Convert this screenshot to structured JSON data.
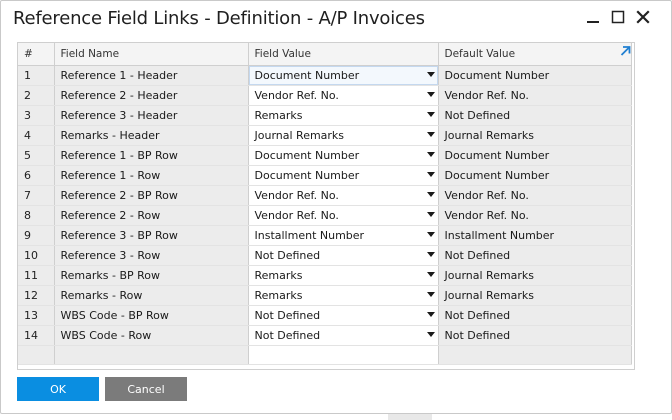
{
  "window": {
    "title": "Reference Field Links - Definition - A/P Invoices"
  },
  "grid": {
    "headers": [
      "#",
      "Field Name",
      "Field Value",
      "Default Value"
    ],
    "rows": [
      {
        "num": "1",
        "field_name": "Reference 1 - Header",
        "field_value": "Document Number",
        "default_value": "Document Number"
      },
      {
        "num": "2",
        "field_name": "Reference 2 - Header",
        "field_value": "Vendor Ref. No.",
        "default_value": "Vendor Ref. No."
      },
      {
        "num": "3",
        "field_name": "Reference 3 - Header",
        "field_value": "Remarks",
        "default_value": "Not Defined"
      },
      {
        "num": "4",
        "field_name": "Remarks - Header",
        "field_value": "Journal Remarks",
        "default_value": "Journal Remarks"
      },
      {
        "num": "5",
        "field_name": "Reference 1 - BP Row",
        "field_value": "Document Number",
        "default_value": "Document Number"
      },
      {
        "num": "6",
        "field_name": "Reference 1 - Row",
        "field_value": "Document Number",
        "default_value": "Document Number"
      },
      {
        "num": "7",
        "field_name": "Reference 2 - BP Row",
        "field_value": "Vendor Ref. No.",
        "default_value": "Vendor Ref. No."
      },
      {
        "num": "8",
        "field_name": "Reference 2 - Row",
        "field_value": "Vendor Ref. No.",
        "default_value": "Vendor Ref. No."
      },
      {
        "num": "9",
        "field_name": "Reference 3 - BP Row",
        "field_value": "Installment Number",
        "default_value": "Installment Number"
      },
      {
        "num": "10",
        "field_name": "Reference 3 - Row",
        "field_value": "Not Defined",
        "default_value": "Not Defined"
      },
      {
        "num": "11",
        "field_name": "Remarks - BP Row",
        "field_value": "Remarks",
        "default_value": "Journal Remarks"
      },
      {
        "num": "12",
        "field_name": "Remarks - Row",
        "field_value": "Remarks",
        "default_value": "Journal Remarks"
      },
      {
        "num": "13",
        "field_name": "WBS Code - BP Row",
        "field_value": "Not Defined",
        "default_value": "Not Defined"
      },
      {
        "num": "14",
        "field_name": "WBS Code - Row",
        "field_value": "Not Defined",
        "default_value": "Not Defined"
      }
    ]
  },
  "buttons": {
    "ok_label": "OK",
    "cancel_label": "Cancel"
  },
  "icons": {
    "minimize": "minimize-icon",
    "maximize": "maximize-icon",
    "close": "close-icon",
    "expand": "expand-arrow-icon",
    "dropdown": "dropdown-arrow-icon"
  },
  "colors": {
    "primary_button": "#0a8ee1",
    "secondary_button": "#7b7b7b",
    "readonly_cell": "#ececec",
    "expand_arrow": "#1f7fd1"
  }
}
